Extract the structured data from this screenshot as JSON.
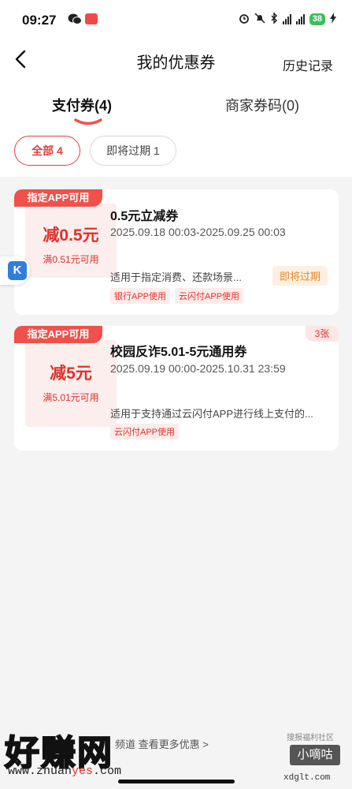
{
  "status_bar": {
    "time": "09:27",
    "battery": "38"
  },
  "nav": {
    "title": "我的优惠券",
    "history": "历史记录"
  },
  "tabs": {
    "pay": "支付券(4)",
    "merchant": "商家券码(0)"
  },
  "filters": {
    "all": "全部 4",
    "expiring": "即将过期 1"
  },
  "coupons": [
    {
      "app_tag": "指定APP可用",
      "amount": "减0.5元",
      "threshold": "满0.51元可用",
      "title": "0.5元立减券",
      "validity": "2025.09.18 00:03-2025.09.25 00:03",
      "description": "适用于指定消费、还款场景...",
      "status_badge": "即将过期",
      "tags": [
        "银行APP使用",
        "云闪付APP使用"
      ]
    },
    {
      "app_tag": "指定APP可用",
      "amount": "减5元",
      "threshold": "满5.01元可用",
      "title": "校园反诈5.01-5元通用券",
      "validity": "2025.09.19 00:00-2025.10.31 23:59",
      "description": "适用于支持通过云闪付APP进行线上支付的...",
      "count_badge": "3张",
      "tags": [
        "云闪付APP使用"
      ]
    }
  ],
  "bottom": {
    "more_link": "频道 查看更多优惠",
    "chevron": ">"
  },
  "watermark": {
    "big": "好赚网",
    "url_prefix": "www.zhuan",
    "url_red": "yes",
    "url_suffix": ".com",
    "badge_caption": "搜报福利社区",
    "badge": "小嘀咕",
    "site": "xdglt.com"
  },
  "colors": {
    "accent_red": "#e0302a",
    "tag_red": "#f0514a",
    "expiring_orange": "#e08a2a",
    "battery_green": "#3bbf5b"
  },
  "icons": [
    "back-arrow-icon",
    "wechat-icon",
    "alarm-icon",
    "mute-icon",
    "bluetooth-icon",
    "signal-icon",
    "battery-icon",
    "side-widget-icon",
    "chevron-right-icon"
  ]
}
